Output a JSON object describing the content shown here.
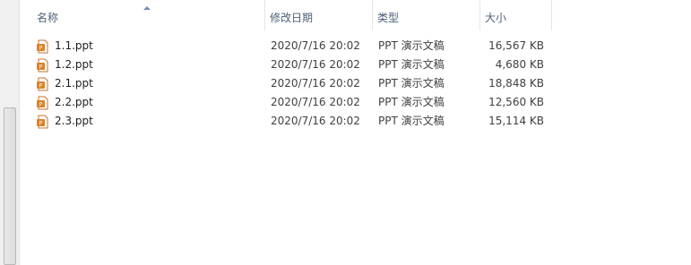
{
  "columns": {
    "name": "名称",
    "date": "修改日期",
    "type": "类型",
    "size": "大小"
  },
  "files": [
    {
      "name": "1.1.ppt",
      "date": "2020/7/16 20:02",
      "type": "PPT 演示文稿",
      "size": "16,567 KB",
      "icon": "ppt-file-icon"
    },
    {
      "name": "1.2.ppt",
      "date": "2020/7/16 20:02",
      "type": "PPT 演示文稿",
      "size": "4,680 KB",
      "icon": "ppt-file-icon"
    },
    {
      "name": "2.1.ppt",
      "date": "2020/7/16 20:02",
      "type": "PPT 演示文稿",
      "size": "18,848 KB",
      "icon": "ppt-file-icon"
    },
    {
      "name": "2.2.ppt",
      "date": "2020/7/16 20:02",
      "type": "PPT 演示文稿",
      "size": "12,560 KB",
      "icon": "ppt-file-icon"
    },
    {
      "name": "2.3.ppt",
      "date": "2020/7/16 20:02",
      "type": "PPT 演示文稿",
      "size": "15,114 KB",
      "icon": "ppt-file-icon"
    }
  ],
  "colors": {
    "icon_orange": "#d9822b",
    "header_text": "#4c607a"
  }
}
